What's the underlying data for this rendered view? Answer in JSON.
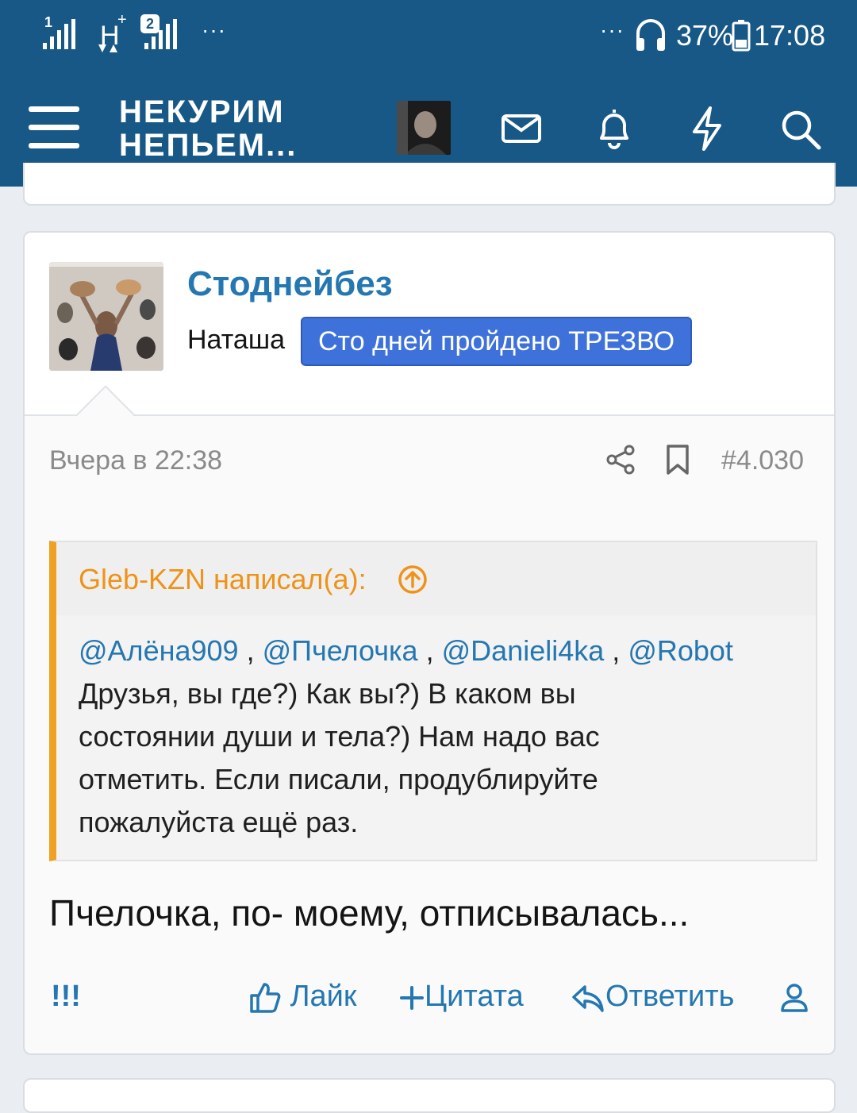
{
  "status_bar": {
    "sim1": "1",
    "network_type": "H",
    "network_plus": "+",
    "sim2": "2",
    "left_more": "···",
    "right_more": "···",
    "battery": "37%",
    "time": "17:08"
  },
  "header": {
    "logo_line1": "НЕКУРИМ",
    "logo_line2": "НЕПЬЕМ...",
    "icons": [
      "menu-icon",
      "envelope-icon",
      "bell-icon",
      "bolt-icon",
      "search-icon"
    ]
  },
  "post": {
    "username": "Стоднейбез",
    "user_title": "Наташа",
    "user_badge": "Сто дней пройдено ТРЕЗВО",
    "date": "Вчера в 22:38",
    "number": "#4.030",
    "quote": {
      "author": "Gleb-KZN написал(а):",
      "mentions": [
        "@Алёна909",
        "@Пчелочка",
        "@Danieli4ka",
        "@Robot"
      ],
      "separator": ",",
      "line1": "Друзья, вы где?) Как вы?) В каком вы",
      "line2": "состоянии души и тела?) Нам надо вас",
      "line3": "отметить. Если писали, продублируйте",
      "line4": "пожалуйста ещё раз."
    },
    "text": "Пчелочка, по- моему, отписывалась...",
    "actions": {
      "report": "!!!",
      "like": "Лайк",
      "quote": "Цитата",
      "reply": "Ответить"
    }
  },
  "colors": {
    "header_bg": "#185886",
    "link": "#2577b1",
    "badge": "#3e72da",
    "quote_accent": "#f0a022"
  }
}
